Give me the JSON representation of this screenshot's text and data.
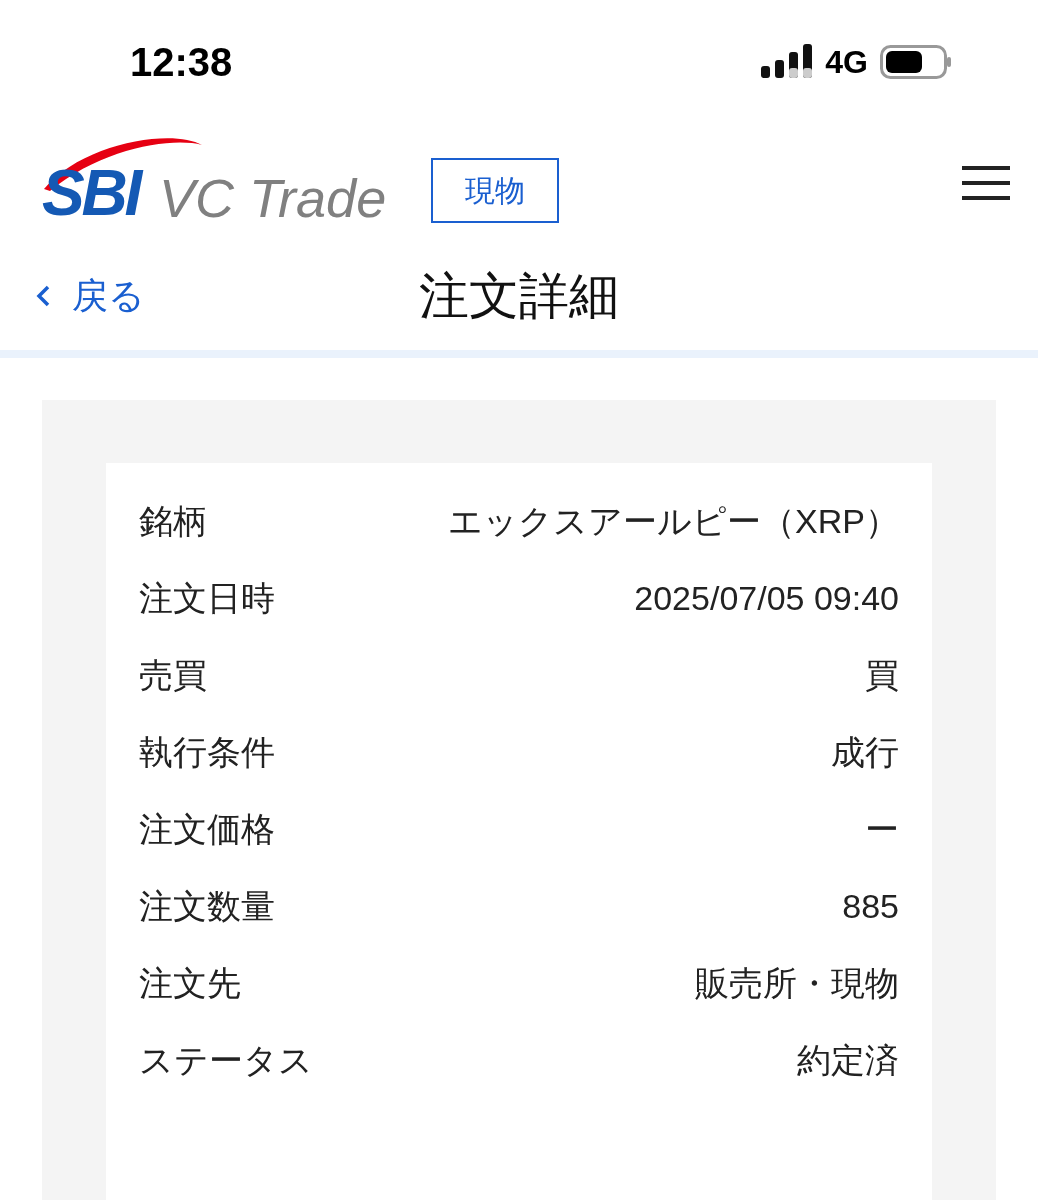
{
  "status_bar": {
    "time": "12:38",
    "network": "4G"
  },
  "header": {
    "logo": {
      "primary": "SBI",
      "secondary": "VC Trade"
    },
    "badge": "現物"
  },
  "nav": {
    "back": "戻る",
    "title": "注文詳細"
  },
  "details": [
    {
      "label": "銘柄",
      "value": "エックスアールピー（XRP）"
    },
    {
      "label": "注文日時",
      "value": "2025/07/05 09:40"
    },
    {
      "label": "売買",
      "value": "買"
    },
    {
      "label": "執行条件",
      "value": "成行"
    },
    {
      "label": "注文価格",
      "value": "ー"
    },
    {
      "label": "注文数量",
      "value": "885"
    },
    {
      "label": "注文先",
      "value": "販売所・現物"
    },
    {
      "label": "ステータス",
      "value": "約定済"
    }
  ]
}
